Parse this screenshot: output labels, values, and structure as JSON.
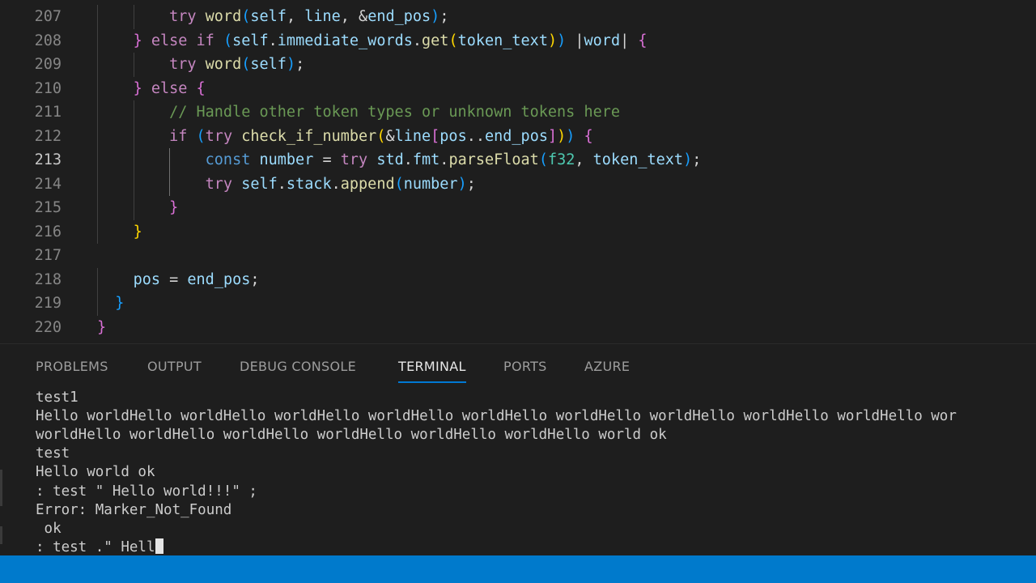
{
  "editor": {
    "lines": [
      {
        "num": "207",
        "parts": [
          {
            "t": "        "
          },
          {
            "t": "try",
            "c": "kw"
          },
          {
            "t": " "
          },
          {
            "t": "word",
            "c": "fn"
          },
          {
            "t": "(",
            "c": "b3"
          },
          {
            "t": "self",
            "c": "vr"
          },
          {
            "t": ", ",
            "c": "pl"
          },
          {
            "t": "line",
            "c": "vr"
          },
          {
            "t": ", &",
            "c": "pl"
          },
          {
            "t": "end_pos",
            "c": "vr"
          },
          {
            "t": ")",
            "c": "b3"
          },
          {
            "t": ";",
            "c": "pl"
          }
        ]
      },
      {
        "num": "208",
        "parts": [
          {
            "t": "    "
          },
          {
            "t": "}",
            "c": "b2"
          },
          {
            "t": " "
          },
          {
            "t": "else if",
            "c": "kw"
          },
          {
            "t": " "
          },
          {
            "t": "(",
            "c": "b3"
          },
          {
            "t": "self",
            "c": "vr"
          },
          {
            "t": ".",
            "c": "pl"
          },
          {
            "t": "immediate_words",
            "c": "vr"
          },
          {
            "t": ".",
            "c": "pl"
          },
          {
            "t": "get",
            "c": "fn"
          },
          {
            "t": "(",
            "c": "b1"
          },
          {
            "t": "token_text",
            "c": "vr"
          },
          {
            "t": ")",
            "c": "b1"
          },
          {
            "t": ")",
            "c": "b3"
          },
          {
            "t": " |",
            "c": "pl"
          },
          {
            "t": "word",
            "c": "vr"
          },
          {
            "t": "| ",
            "c": "pl"
          },
          {
            "t": "{",
            "c": "b2"
          }
        ]
      },
      {
        "num": "209",
        "parts": [
          {
            "t": "        "
          },
          {
            "t": "try",
            "c": "kw"
          },
          {
            "t": " "
          },
          {
            "t": "word",
            "c": "fn"
          },
          {
            "t": "(",
            "c": "b3"
          },
          {
            "t": "self",
            "c": "vr"
          },
          {
            "t": ")",
            "c": "b3"
          },
          {
            "t": ";",
            "c": "pl"
          }
        ]
      },
      {
        "num": "210",
        "parts": [
          {
            "t": "    "
          },
          {
            "t": "}",
            "c": "b2"
          },
          {
            "t": " "
          },
          {
            "t": "else",
            "c": "kw"
          },
          {
            "t": " "
          },
          {
            "t": "{",
            "c": "b2"
          }
        ]
      },
      {
        "num": "211",
        "parts": [
          {
            "t": "        "
          },
          {
            "t": "// Handle other token types or unknown tokens here",
            "c": "cm"
          }
        ]
      },
      {
        "num": "212",
        "parts": [
          {
            "t": "        "
          },
          {
            "t": "if",
            "c": "kw"
          },
          {
            "t": " "
          },
          {
            "t": "(",
            "c": "b3"
          },
          {
            "t": "try",
            "c": "kw"
          },
          {
            "t": " "
          },
          {
            "t": "check_if_number",
            "c": "fn"
          },
          {
            "t": "(",
            "c": "b1"
          },
          {
            "t": "&",
            "c": "pl"
          },
          {
            "t": "line",
            "c": "vr"
          },
          {
            "t": "[",
            "c": "b2"
          },
          {
            "t": "pos",
            "c": "vr"
          },
          {
            "t": "..",
            "c": "pl"
          },
          {
            "t": "end_pos",
            "c": "vr"
          },
          {
            "t": "]",
            "c": "b2"
          },
          {
            "t": ")",
            "c": "b1"
          },
          {
            "t": ")",
            "c": "b3"
          },
          {
            "t": " "
          },
          {
            "t": "{",
            "c": "b2"
          }
        ]
      },
      {
        "num": "213",
        "active": true,
        "parts": [
          {
            "t": "            "
          },
          {
            "t": "const",
            "c": "dc"
          },
          {
            "t": " "
          },
          {
            "t": "number",
            "c": "vr"
          },
          {
            "t": " = ",
            "c": "pl"
          },
          {
            "t": "try",
            "c": "kw"
          },
          {
            "t": " "
          },
          {
            "t": "std",
            "c": "vr"
          },
          {
            "t": ".",
            "c": "pl"
          },
          {
            "t": "fmt",
            "c": "vr"
          },
          {
            "t": ".",
            "c": "pl"
          },
          {
            "t": "parseFloat",
            "c": "fn"
          },
          {
            "t": "(",
            "c": "b3"
          },
          {
            "t": "f32",
            "c": "ty"
          },
          {
            "t": ", ",
            "c": "pl"
          },
          {
            "t": "token_text",
            "c": "vr"
          },
          {
            "t": ")",
            "c": "b3"
          },
          {
            "t": ";",
            "c": "pl"
          }
        ]
      },
      {
        "num": "214",
        "parts": [
          {
            "t": "            "
          },
          {
            "t": "try",
            "c": "kw"
          },
          {
            "t": " "
          },
          {
            "t": "self",
            "c": "vr"
          },
          {
            "t": ".",
            "c": "pl"
          },
          {
            "t": "stack",
            "c": "vr"
          },
          {
            "t": ".",
            "c": "pl"
          },
          {
            "t": "append",
            "c": "fn"
          },
          {
            "t": "(",
            "c": "b3"
          },
          {
            "t": "number",
            "c": "vr"
          },
          {
            "t": ")",
            "c": "b3"
          },
          {
            "t": ";",
            "c": "pl"
          }
        ]
      },
      {
        "num": "215",
        "parts": [
          {
            "t": "        "
          },
          {
            "t": "}",
            "c": "b2"
          }
        ]
      },
      {
        "num": "216",
        "parts": [
          {
            "t": "    "
          },
          {
            "t": "}",
            "c": "b1"
          }
        ]
      },
      {
        "num": "217",
        "parts": []
      },
      {
        "num": "218",
        "parts": [
          {
            "t": "    "
          },
          {
            "t": "pos",
            "c": "vr"
          },
          {
            "t": " = ",
            "c": "pl"
          },
          {
            "t": "end_pos",
            "c": "vr"
          },
          {
            "t": ";",
            "c": "pl"
          }
        ]
      },
      {
        "num": "219",
        "parts": [
          {
            "t": "  "
          },
          {
            "t": "}",
            "c": "b3"
          }
        ]
      },
      {
        "num": "220",
        "parts": [
          {
            "t": "}",
            "c": "b2"
          }
        ]
      }
    ]
  },
  "panel": {
    "tabs": [
      {
        "label": "PROBLEMS",
        "active": false
      },
      {
        "label": "OUTPUT",
        "active": false
      },
      {
        "label": "DEBUG CONSOLE",
        "active": false
      },
      {
        "label": "TERMINAL",
        "active": true
      },
      {
        "label": "PORTS",
        "active": false
      },
      {
        "label": "AZURE",
        "active": false
      }
    ],
    "terminal_lines": [
      "test1",
      "Hello worldHello worldHello worldHello worldHello worldHello worldHello worldHello worldHello worldHello wor",
      "worldHello worldHello worldHello worldHello worldHello worldHello world ok",
      "test",
      "Hello world ok",
      ": test \" Hello world!!!\" ;",
      "Error: Marker_Not_Found",
      " ok",
      ": test .\" Hell"
    ]
  },
  "colors": {
    "editor_bg": "#1e1e1e",
    "status_bar": "#007acc",
    "active_tab_underline": "#0078d4"
  }
}
